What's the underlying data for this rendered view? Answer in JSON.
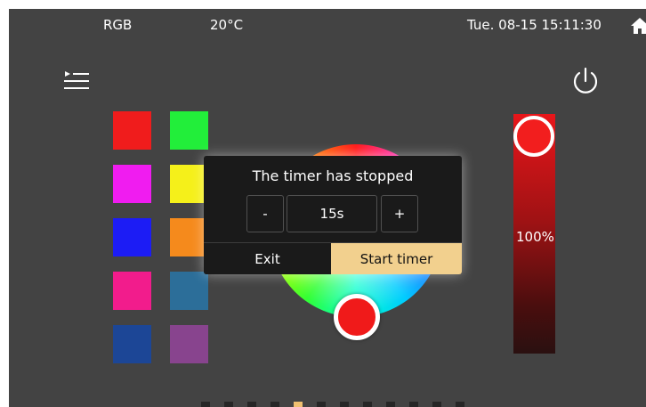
{
  "status_bar": {
    "mode": "RGB",
    "temperature": "20°C",
    "datetime": "Tue. 08-15 15:11:30",
    "home_icon": "home-icon"
  },
  "toolbar": {
    "menu_icon": "menu-icon",
    "power_icon": "power-icon"
  },
  "swatches": [
    {
      "color": "#f01c1c"
    },
    {
      "color": "#22ee3a"
    },
    {
      "color": "#f01cf0"
    },
    {
      "color": "#f5f01a"
    },
    {
      "color": "#1c1cf5"
    },
    {
      "color": "#f58a1c"
    },
    {
      "color": "#f21c8c"
    },
    {
      "color": "#2c6e99"
    },
    {
      "color": "#1c4696"
    },
    {
      "color": "#88448e"
    }
  ],
  "color_wheel": {
    "selected_color": "#f01a1a"
  },
  "brightness": {
    "value": "100%",
    "level": 1.0,
    "color": "#e8161a"
  },
  "pager": {
    "count": 12,
    "active_index": 4
  },
  "timer_dialog": {
    "title": "The timer has stopped",
    "decrement_label": "-",
    "duration": "15s",
    "increment_label": "+",
    "exit_label": "Exit",
    "start_label": "Start timer"
  }
}
